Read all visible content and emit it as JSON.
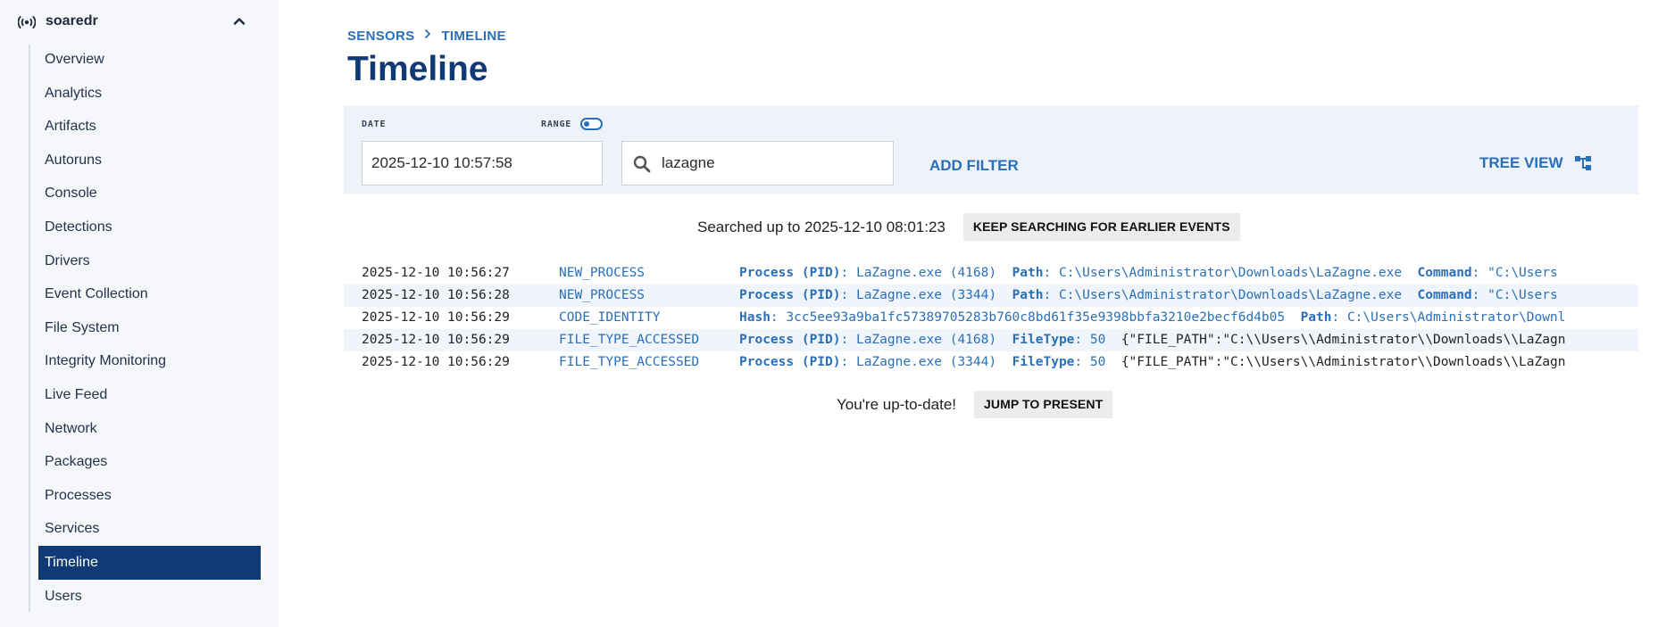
{
  "sidebar": {
    "sensor_name": "soaredr",
    "items": [
      {
        "label": "Overview",
        "active": false
      },
      {
        "label": "Analytics",
        "active": false
      },
      {
        "label": "Artifacts",
        "active": false
      },
      {
        "label": "Autoruns",
        "active": false
      },
      {
        "label": "Console",
        "active": false
      },
      {
        "label": "Detections",
        "active": false
      },
      {
        "label": "Drivers",
        "active": false
      },
      {
        "label": "Event Collection",
        "active": false
      },
      {
        "label": "File System",
        "active": false
      },
      {
        "label": "Integrity Monitoring",
        "active": false
      },
      {
        "label": "Live Feed",
        "active": false
      },
      {
        "label": "Network",
        "active": false
      },
      {
        "label": "Packages",
        "active": false
      },
      {
        "label": "Processes",
        "active": false
      },
      {
        "label": "Services",
        "active": false
      },
      {
        "label": "Timeline",
        "active": true
      },
      {
        "label": "Users",
        "active": false
      }
    ]
  },
  "breadcrumb": {
    "parent": "SENSORS",
    "current": "TIMELINE"
  },
  "page_title": "Timeline",
  "filters": {
    "date_label": "DATE",
    "range_label": "RANGE",
    "range_enabled": false,
    "date_value": "2025-12-10 10:57:58",
    "search_value": "lazagne",
    "add_filter_label": "ADD FILTER",
    "tree_view_label": "TREE VIEW"
  },
  "search_status": {
    "text": "Searched up to 2025-12-10 08:01:23",
    "button": "KEEP SEARCHING FOR EARLIER EVENTS"
  },
  "events": [
    {
      "time": "2025-12-10 10:56:27",
      "type": "NEW_PROCESS",
      "fields": [
        {
          "key": "Process (PID)",
          "value": "LaZagne.exe (4168)"
        },
        {
          "key": "Path",
          "value": "C:\\Users\\Administrator\\Downloads\\LaZagne.exe"
        },
        {
          "key": "Command",
          "value": "\"C:\\Users"
        }
      ],
      "raw": ""
    },
    {
      "time": "2025-12-10 10:56:28",
      "type": "NEW_PROCESS",
      "fields": [
        {
          "key": "Process (PID)",
          "value": "LaZagne.exe (3344)"
        },
        {
          "key": "Path",
          "value": "C:\\Users\\Administrator\\Downloads\\LaZagne.exe"
        },
        {
          "key": "Command",
          "value": "\"C:\\Users"
        }
      ],
      "raw": ""
    },
    {
      "time": "2025-12-10 10:56:29",
      "type": "CODE_IDENTITY",
      "fields": [
        {
          "key": "Hash",
          "value": "3cc5ee93a9ba1fc57389705283b760c8bd61f35e9398bbfa3210e2becf6d4b05"
        },
        {
          "key": "Path",
          "value": "C:\\Users\\Administrator\\Downl"
        }
      ],
      "raw": ""
    },
    {
      "time": "2025-12-10 10:56:29",
      "type": "FILE_TYPE_ACCESSED",
      "fields": [
        {
          "key": "Process (PID)",
          "value": "LaZagne.exe (4168)"
        },
        {
          "key": "FileType",
          "value": "50"
        }
      ],
      "raw": "{\"FILE_PATH\":\"C:\\\\Users\\\\Administrator\\\\Downloads\\\\LaZagn"
    },
    {
      "time": "2025-12-10 10:56:29",
      "type": "FILE_TYPE_ACCESSED",
      "fields": [
        {
          "key": "Process (PID)",
          "value": "LaZagne.exe (3344)"
        },
        {
          "key": "FileType",
          "value": "50"
        }
      ],
      "raw": "{\"FILE_PATH\":\"C:\\\\Users\\\\Administrator\\\\Downloads\\\\LaZagn"
    }
  ],
  "up_to_date": {
    "text": "You're up-to-date!",
    "button": "JUMP TO PRESENT"
  },
  "colors": {
    "accent": "#2a6fb8",
    "title": "#0f3a76",
    "active_nav": "#0f3a76",
    "filter_bg": "#eef3fa",
    "sidebar_bg": "#f5f7fa"
  }
}
